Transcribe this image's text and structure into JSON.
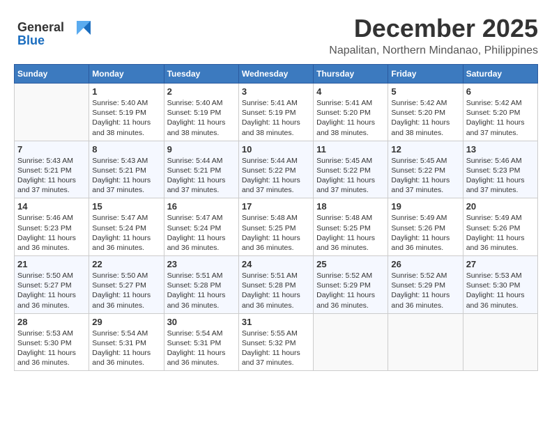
{
  "logo": {
    "general": "General",
    "blue": "Blue"
  },
  "title": {
    "month_year": "December 2025",
    "location": "Napalitan, Northern Mindanao, Philippines"
  },
  "weekdays": [
    "Sunday",
    "Monday",
    "Tuesday",
    "Wednesday",
    "Thursday",
    "Friday",
    "Saturday"
  ],
  "weeks": [
    [
      {
        "day": "",
        "sunrise": "",
        "sunset": "",
        "daylight": ""
      },
      {
        "day": "1",
        "sunrise": "Sunrise: 5:40 AM",
        "sunset": "Sunset: 5:19 PM",
        "daylight": "Daylight: 11 hours and 38 minutes."
      },
      {
        "day": "2",
        "sunrise": "Sunrise: 5:40 AM",
        "sunset": "Sunset: 5:19 PM",
        "daylight": "Daylight: 11 hours and 38 minutes."
      },
      {
        "day": "3",
        "sunrise": "Sunrise: 5:41 AM",
        "sunset": "Sunset: 5:19 PM",
        "daylight": "Daylight: 11 hours and 38 minutes."
      },
      {
        "day": "4",
        "sunrise": "Sunrise: 5:41 AM",
        "sunset": "Sunset: 5:20 PM",
        "daylight": "Daylight: 11 hours and 38 minutes."
      },
      {
        "day": "5",
        "sunrise": "Sunrise: 5:42 AM",
        "sunset": "Sunset: 5:20 PM",
        "daylight": "Daylight: 11 hours and 38 minutes."
      },
      {
        "day": "6",
        "sunrise": "Sunrise: 5:42 AM",
        "sunset": "Sunset: 5:20 PM",
        "daylight": "Daylight: 11 hours and 37 minutes."
      }
    ],
    [
      {
        "day": "7",
        "sunrise": "Sunrise: 5:43 AM",
        "sunset": "Sunset: 5:21 PM",
        "daylight": "Daylight: 11 hours and 37 minutes."
      },
      {
        "day": "8",
        "sunrise": "Sunrise: 5:43 AM",
        "sunset": "Sunset: 5:21 PM",
        "daylight": "Daylight: 11 hours and 37 minutes."
      },
      {
        "day": "9",
        "sunrise": "Sunrise: 5:44 AM",
        "sunset": "Sunset: 5:21 PM",
        "daylight": "Daylight: 11 hours and 37 minutes."
      },
      {
        "day": "10",
        "sunrise": "Sunrise: 5:44 AM",
        "sunset": "Sunset: 5:22 PM",
        "daylight": "Daylight: 11 hours and 37 minutes."
      },
      {
        "day": "11",
        "sunrise": "Sunrise: 5:45 AM",
        "sunset": "Sunset: 5:22 PM",
        "daylight": "Daylight: 11 hours and 37 minutes."
      },
      {
        "day": "12",
        "sunrise": "Sunrise: 5:45 AM",
        "sunset": "Sunset: 5:22 PM",
        "daylight": "Daylight: 11 hours and 37 minutes."
      },
      {
        "day": "13",
        "sunrise": "Sunrise: 5:46 AM",
        "sunset": "Sunset: 5:23 PM",
        "daylight": "Daylight: 11 hours and 37 minutes."
      }
    ],
    [
      {
        "day": "14",
        "sunrise": "Sunrise: 5:46 AM",
        "sunset": "Sunset: 5:23 PM",
        "daylight": "Daylight: 11 hours and 36 minutes."
      },
      {
        "day": "15",
        "sunrise": "Sunrise: 5:47 AM",
        "sunset": "Sunset: 5:24 PM",
        "daylight": "Daylight: 11 hours and 36 minutes."
      },
      {
        "day": "16",
        "sunrise": "Sunrise: 5:47 AM",
        "sunset": "Sunset: 5:24 PM",
        "daylight": "Daylight: 11 hours and 36 minutes."
      },
      {
        "day": "17",
        "sunrise": "Sunrise: 5:48 AM",
        "sunset": "Sunset: 5:25 PM",
        "daylight": "Daylight: 11 hours and 36 minutes."
      },
      {
        "day": "18",
        "sunrise": "Sunrise: 5:48 AM",
        "sunset": "Sunset: 5:25 PM",
        "daylight": "Daylight: 11 hours and 36 minutes."
      },
      {
        "day": "19",
        "sunrise": "Sunrise: 5:49 AM",
        "sunset": "Sunset: 5:26 PM",
        "daylight": "Daylight: 11 hours and 36 minutes."
      },
      {
        "day": "20",
        "sunrise": "Sunrise: 5:49 AM",
        "sunset": "Sunset: 5:26 PM",
        "daylight": "Daylight: 11 hours and 36 minutes."
      }
    ],
    [
      {
        "day": "21",
        "sunrise": "Sunrise: 5:50 AM",
        "sunset": "Sunset: 5:27 PM",
        "daylight": "Daylight: 11 hours and 36 minutes."
      },
      {
        "day": "22",
        "sunrise": "Sunrise: 5:50 AM",
        "sunset": "Sunset: 5:27 PM",
        "daylight": "Daylight: 11 hours and 36 minutes."
      },
      {
        "day": "23",
        "sunrise": "Sunrise: 5:51 AM",
        "sunset": "Sunset: 5:28 PM",
        "daylight": "Daylight: 11 hours and 36 minutes."
      },
      {
        "day": "24",
        "sunrise": "Sunrise: 5:51 AM",
        "sunset": "Sunset: 5:28 PM",
        "daylight": "Daylight: 11 hours and 36 minutes."
      },
      {
        "day": "25",
        "sunrise": "Sunrise: 5:52 AM",
        "sunset": "Sunset: 5:29 PM",
        "daylight": "Daylight: 11 hours and 36 minutes."
      },
      {
        "day": "26",
        "sunrise": "Sunrise: 5:52 AM",
        "sunset": "Sunset: 5:29 PM",
        "daylight": "Daylight: 11 hours and 36 minutes."
      },
      {
        "day": "27",
        "sunrise": "Sunrise: 5:53 AM",
        "sunset": "Sunset: 5:30 PM",
        "daylight": "Daylight: 11 hours and 36 minutes."
      }
    ],
    [
      {
        "day": "28",
        "sunrise": "Sunrise: 5:53 AM",
        "sunset": "Sunset: 5:30 PM",
        "daylight": "Daylight: 11 hours and 36 minutes."
      },
      {
        "day": "29",
        "sunrise": "Sunrise: 5:54 AM",
        "sunset": "Sunset: 5:31 PM",
        "daylight": "Daylight: 11 hours and 36 minutes."
      },
      {
        "day": "30",
        "sunrise": "Sunrise: 5:54 AM",
        "sunset": "Sunset: 5:31 PM",
        "daylight": "Daylight: 11 hours and 36 minutes."
      },
      {
        "day": "31",
        "sunrise": "Sunrise: 5:55 AM",
        "sunset": "Sunset: 5:32 PM",
        "daylight": "Daylight: 11 hours and 37 minutes."
      },
      {
        "day": "",
        "sunrise": "",
        "sunset": "",
        "daylight": ""
      },
      {
        "day": "",
        "sunrise": "",
        "sunset": "",
        "daylight": ""
      },
      {
        "day": "",
        "sunrise": "",
        "sunset": "",
        "daylight": ""
      }
    ]
  ]
}
